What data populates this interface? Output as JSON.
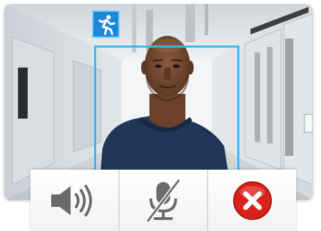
{
  "controls": [
    {
      "icon": "speaker-icon",
      "action": "speaker"
    },
    {
      "icon": "microphone-muted-icon",
      "action": "mute"
    },
    {
      "icon": "close-icon",
      "action": "close"
    }
  ],
  "overlays": {
    "motion_icon": "running-person-icon",
    "detection": "face-detection-box"
  },
  "colors": {
    "accent_blue": "#38b8f0",
    "badge_blue": "#1e88d8",
    "close_red": "#d9231a",
    "icon_gray": "#6a6a6a"
  }
}
